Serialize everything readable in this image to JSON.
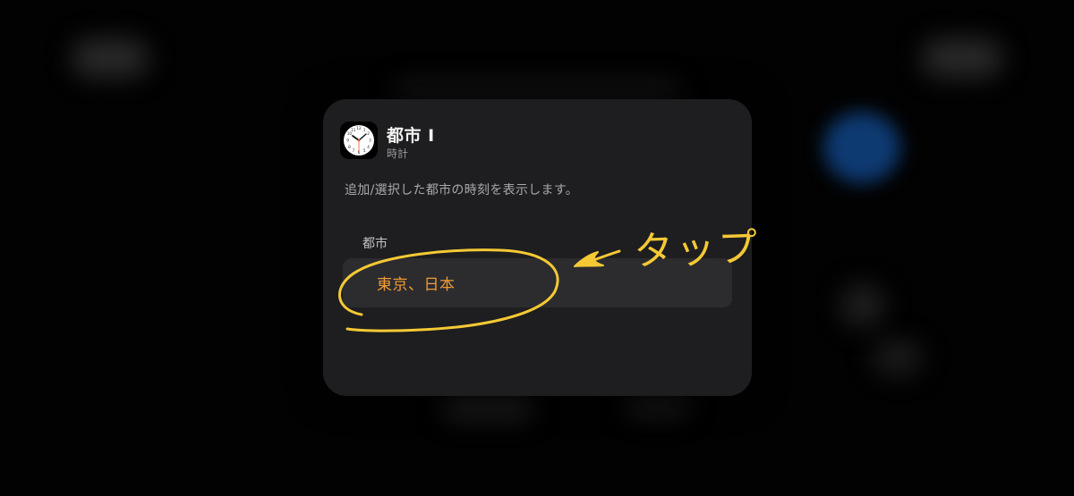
{
  "widget": {
    "title": "都市 I",
    "app_name": "時計",
    "icon": "clock-icon",
    "description": "追加/選択した都市の時刻を表示します。"
  },
  "settings": {
    "city_label": "都市",
    "city_value": "東京、日本"
  },
  "annotation": {
    "text": "タップ",
    "color": "#f5c935"
  },
  "colors": {
    "card_background": "#1e1e20",
    "field_background": "#2c2c2e",
    "accent": "#f19a36",
    "highlight_stroke": "#f5c935"
  }
}
